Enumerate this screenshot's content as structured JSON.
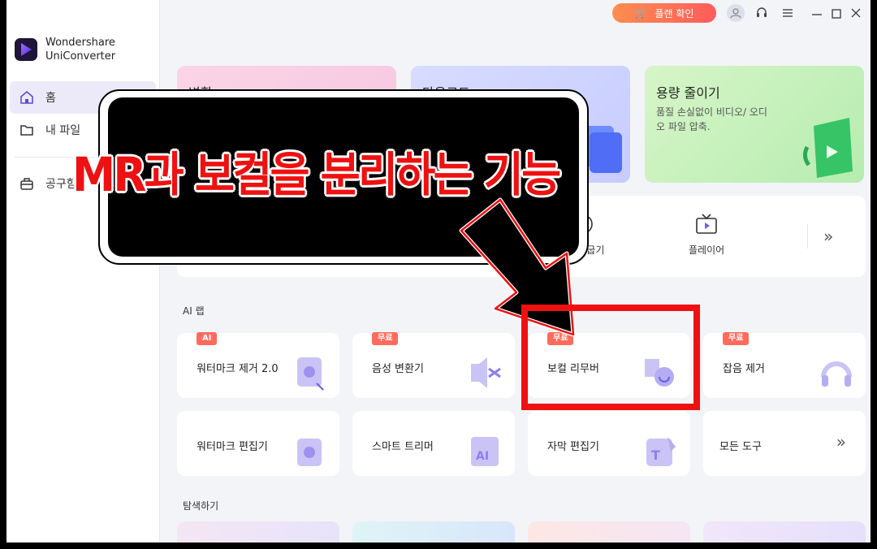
{
  "app": {
    "brand_line1": "Wondershare",
    "brand_line2": "UniConverter"
  },
  "sidebar": {
    "items": [
      {
        "label": "홈",
        "active": true
      },
      {
        "label": "내 파일",
        "active": false
      },
      {
        "label": "공구함",
        "active": false
      }
    ]
  },
  "titlebar": {
    "plan_button": "플랜 확인"
  },
  "hero": [
    {
      "title": "변환",
      "desc": ""
    },
    {
      "title": "다운로드",
      "desc": ""
    },
    {
      "title": "용량 줄이기",
      "desc": "품질 손실없이 비디오/ 오디오 파일 압축."
    }
  ],
  "tools_strip": [
    {
      "label": "DVD 굽기",
      "icon": "disc-icon"
    },
    {
      "label": "플레이어",
      "icon": "tv-icon"
    }
  ],
  "ai_lab": {
    "title": "AI 랩",
    "cards": [
      {
        "label": "워터마크 제거 2.0",
        "badge": "AI"
      },
      {
        "label": "음성 변환기",
        "badge": "무료"
      },
      {
        "label": "보컬 리무버",
        "badge": "무료"
      },
      {
        "label": "잡음 제거",
        "badge": "무료"
      },
      {
        "label": "워터마크 편집기",
        "badge": ""
      },
      {
        "label": "스마트 트리머",
        "badge": ""
      },
      {
        "label": "자막 편집기",
        "badge": ""
      },
      {
        "label": "모든 도구",
        "badge": ""
      }
    ]
  },
  "explore": {
    "title": "탐색하기"
  },
  "overlay": {
    "caption": "MR과 보컬을 분리하는 기능"
  },
  "colors": {
    "accent": "#6c5ce7",
    "highlight": "#ee1111",
    "badge": "#ff6b5b"
  }
}
